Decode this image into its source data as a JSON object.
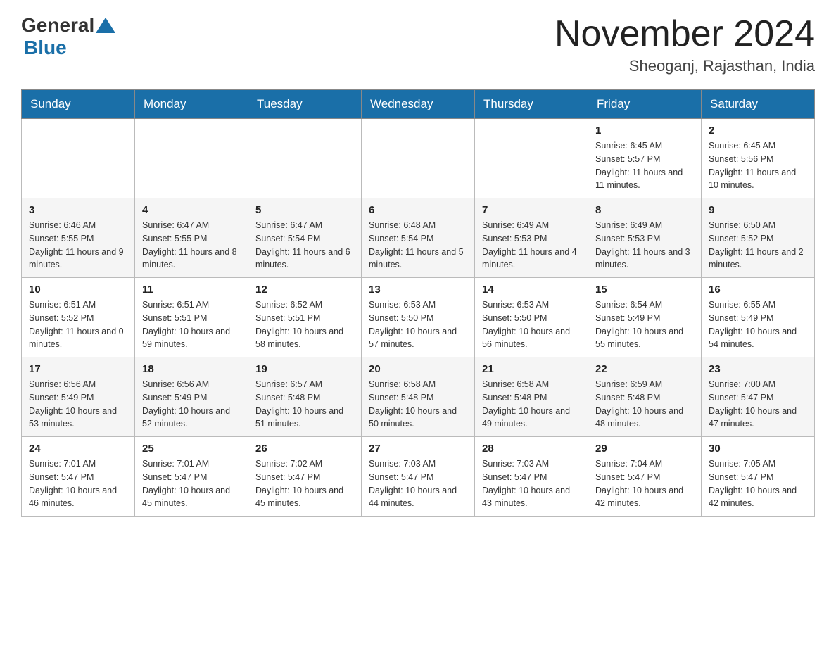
{
  "header": {
    "logo_general": "General",
    "logo_blue": "Blue",
    "month_title": "November 2024",
    "location": "Sheoganj, Rajasthan, India"
  },
  "days_of_week": [
    "Sunday",
    "Monday",
    "Tuesday",
    "Wednesday",
    "Thursday",
    "Friday",
    "Saturday"
  ],
  "weeks": [
    {
      "days": [
        {
          "date": "",
          "info": ""
        },
        {
          "date": "",
          "info": ""
        },
        {
          "date": "",
          "info": ""
        },
        {
          "date": "",
          "info": ""
        },
        {
          "date": "",
          "info": ""
        },
        {
          "date": "1",
          "info": "Sunrise: 6:45 AM\nSunset: 5:57 PM\nDaylight: 11 hours and 11 minutes."
        },
        {
          "date": "2",
          "info": "Sunrise: 6:45 AM\nSunset: 5:56 PM\nDaylight: 11 hours and 10 minutes."
        }
      ]
    },
    {
      "days": [
        {
          "date": "3",
          "info": "Sunrise: 6:46 AM\nSunset: 5:55 PM\nDaylight: 11 hours and 9 minutes."
        },
        {
          "date": "4",
          "info": "Sunrise: 6:47 AM\nSunset: 5:55 PM\nDaylight: 11 hours and 8 minutes."
        },
        {
          "date": "5",
          "info": "Sunrise: 6:47 AM\nSunset: 5:54 PM\nDaylight: 11 hours and 6 minutes."
        },
        {
          "date": "6",
          "info": "Sunrise: 6:48 AM\nSunset: 5:54 PM\nDaylight: 11 hours and 5 minutes."
        },
        {
          "date": "7",
          "info": "Sunrise: 6:49 AM\nSunset: 5:53 PM\nDaylight: 11 hours and 4 minutes."
        },
        {
          "date": "8",
          "info": "Sunrise: 6:49 AM\nSunset: 5:53 PM\nDaylight: 11 hours and 3 minutes."
        },
        {
          "date": "9",
          "info": "Sunrise: 6:50 AM\nSunset: 5:52 PM\nDaylight: 11 hours and 2 minutes."
        }
      ]
    },
    {
      "days": [
        {
          "date": "10",
          "info": "Sunrise: 6:51 AM\nSunset: 5:52 PM\nDaylight: 11 hours and 0 minutes."
        },
        {
          "date": "11",
          "info": "Sunrise: 6:51 AM\nSunset: 5:51 PM\nDaylight: 10 hours and 59 minutes."
        },
        {
          "date": "12",
          "info": "Sunrise: 6:52 AM\nSunset: 5:51 PM\nDaylight: 10 hours and 58 minutes."
        },
        {
          "date": "13",
          "info": "Sunrise: 6:53 AM\nSunset: 5:50 PM\nDaylight: 10 hours and 57 minutes."
        },
        {
          "date": "14",
          "info": "Sunrise: 6:53 AM\nSunset: 5:50 PM\nDaylight: 10 hours and 56 minutes."
        },
        {
          "date": "15",
          "info": "Sunrise: 6:54 AM\nSunset: 5:49 PM\nDaylight: 10 hours and 55 minutes."
        },
        {
          "date": "16",
          "info": "Sunrise: 6:55 AM\nSunset: 5:49 PM\nDaylight: 10 hours and 54 minutes."
        }
      ]
    },
    {
      "days": [
        {
          "date": "17",
          "info": "Sunrise: 6:56 AM\nSunset: 5:49 PM\nDaylight: 10 hours and 53 minutes."
        },
        {
          "date": "18",
          "info": "Sunrise: 6:56 AM\nSunset: 5:49 PM\nDaylight: 10 hours and 52 minutes."
        },
        {
          "date": "19",
          "info": "Sunrise: 6:57 AM\nSunset: 5:48 PM\nDaylight: 10 hours and 51 minutes."
        },
        {
          "date": "20",
          "info": "Sunrise: 6:58 AM\nSunset: 5:48 PM\nDaylight: 10 hours and 50 minutes."
        },
        {
          "date": "21",
          "info": "Sunrise: 6:58 AM\nSunset: 5:48 PM\nDaylight: 10 hours and 49 minutes."
        },
        {
          "date": "22",
          "info": "Sunrise: 6:59 AM\nSunset: 5:48 PM\nDaylight: 10 hours and 48 minutes."
        },
        {
          "date": "23",
          "info": "Sunrise: 7:00 AM\nSunset: 5:47 PM\nDaylight: 10 hours and 47 minutes."
        }
      ]
    },
    {
      "days": [
        {
          "date": "24",
          "info": "Sunrise: 7:01 AM\nSunset: 5:47 PM\nDaylight: 10 hours and 46 minutes."
        },
        {
          "date": "25",
          "info": "Sunrise: 7:01 AM\nSunset: 5:47 PM\nDaylight: 10 hours and 45 minutes."
        },
        {
          "date": "26",
          "info": "Sunrise: 7:02 AM\nSunset: 5:47 PM\nDaylight: 10 hours and 45 minutes."
        },
        {
          "date": "27",
          "info": "Sunrise: 7:03 AM\nSunset: 5:47 PM\nDaylight: 10 hours and 44 minutes."
        },
        {
          "date": "28",
          "info": "Sunrise: 7:03 AM\nSunset: 5:47 PM\nDaylight: 10 hours and 43 minutes."
        },
        {
          "date": "29",
          "info": "Sunrise: 7:04 AM\nSunset: 5:47 PM\nDaylight: 10 hours and 42 minutes."
        },
        {
          "date": "30",
          "info": "Sunrise: 7:05 AM\nSunset: 5:47 PM\nDaylight: 10 hours and 42 minutes."
        }
      ]
    }
  ]
}
